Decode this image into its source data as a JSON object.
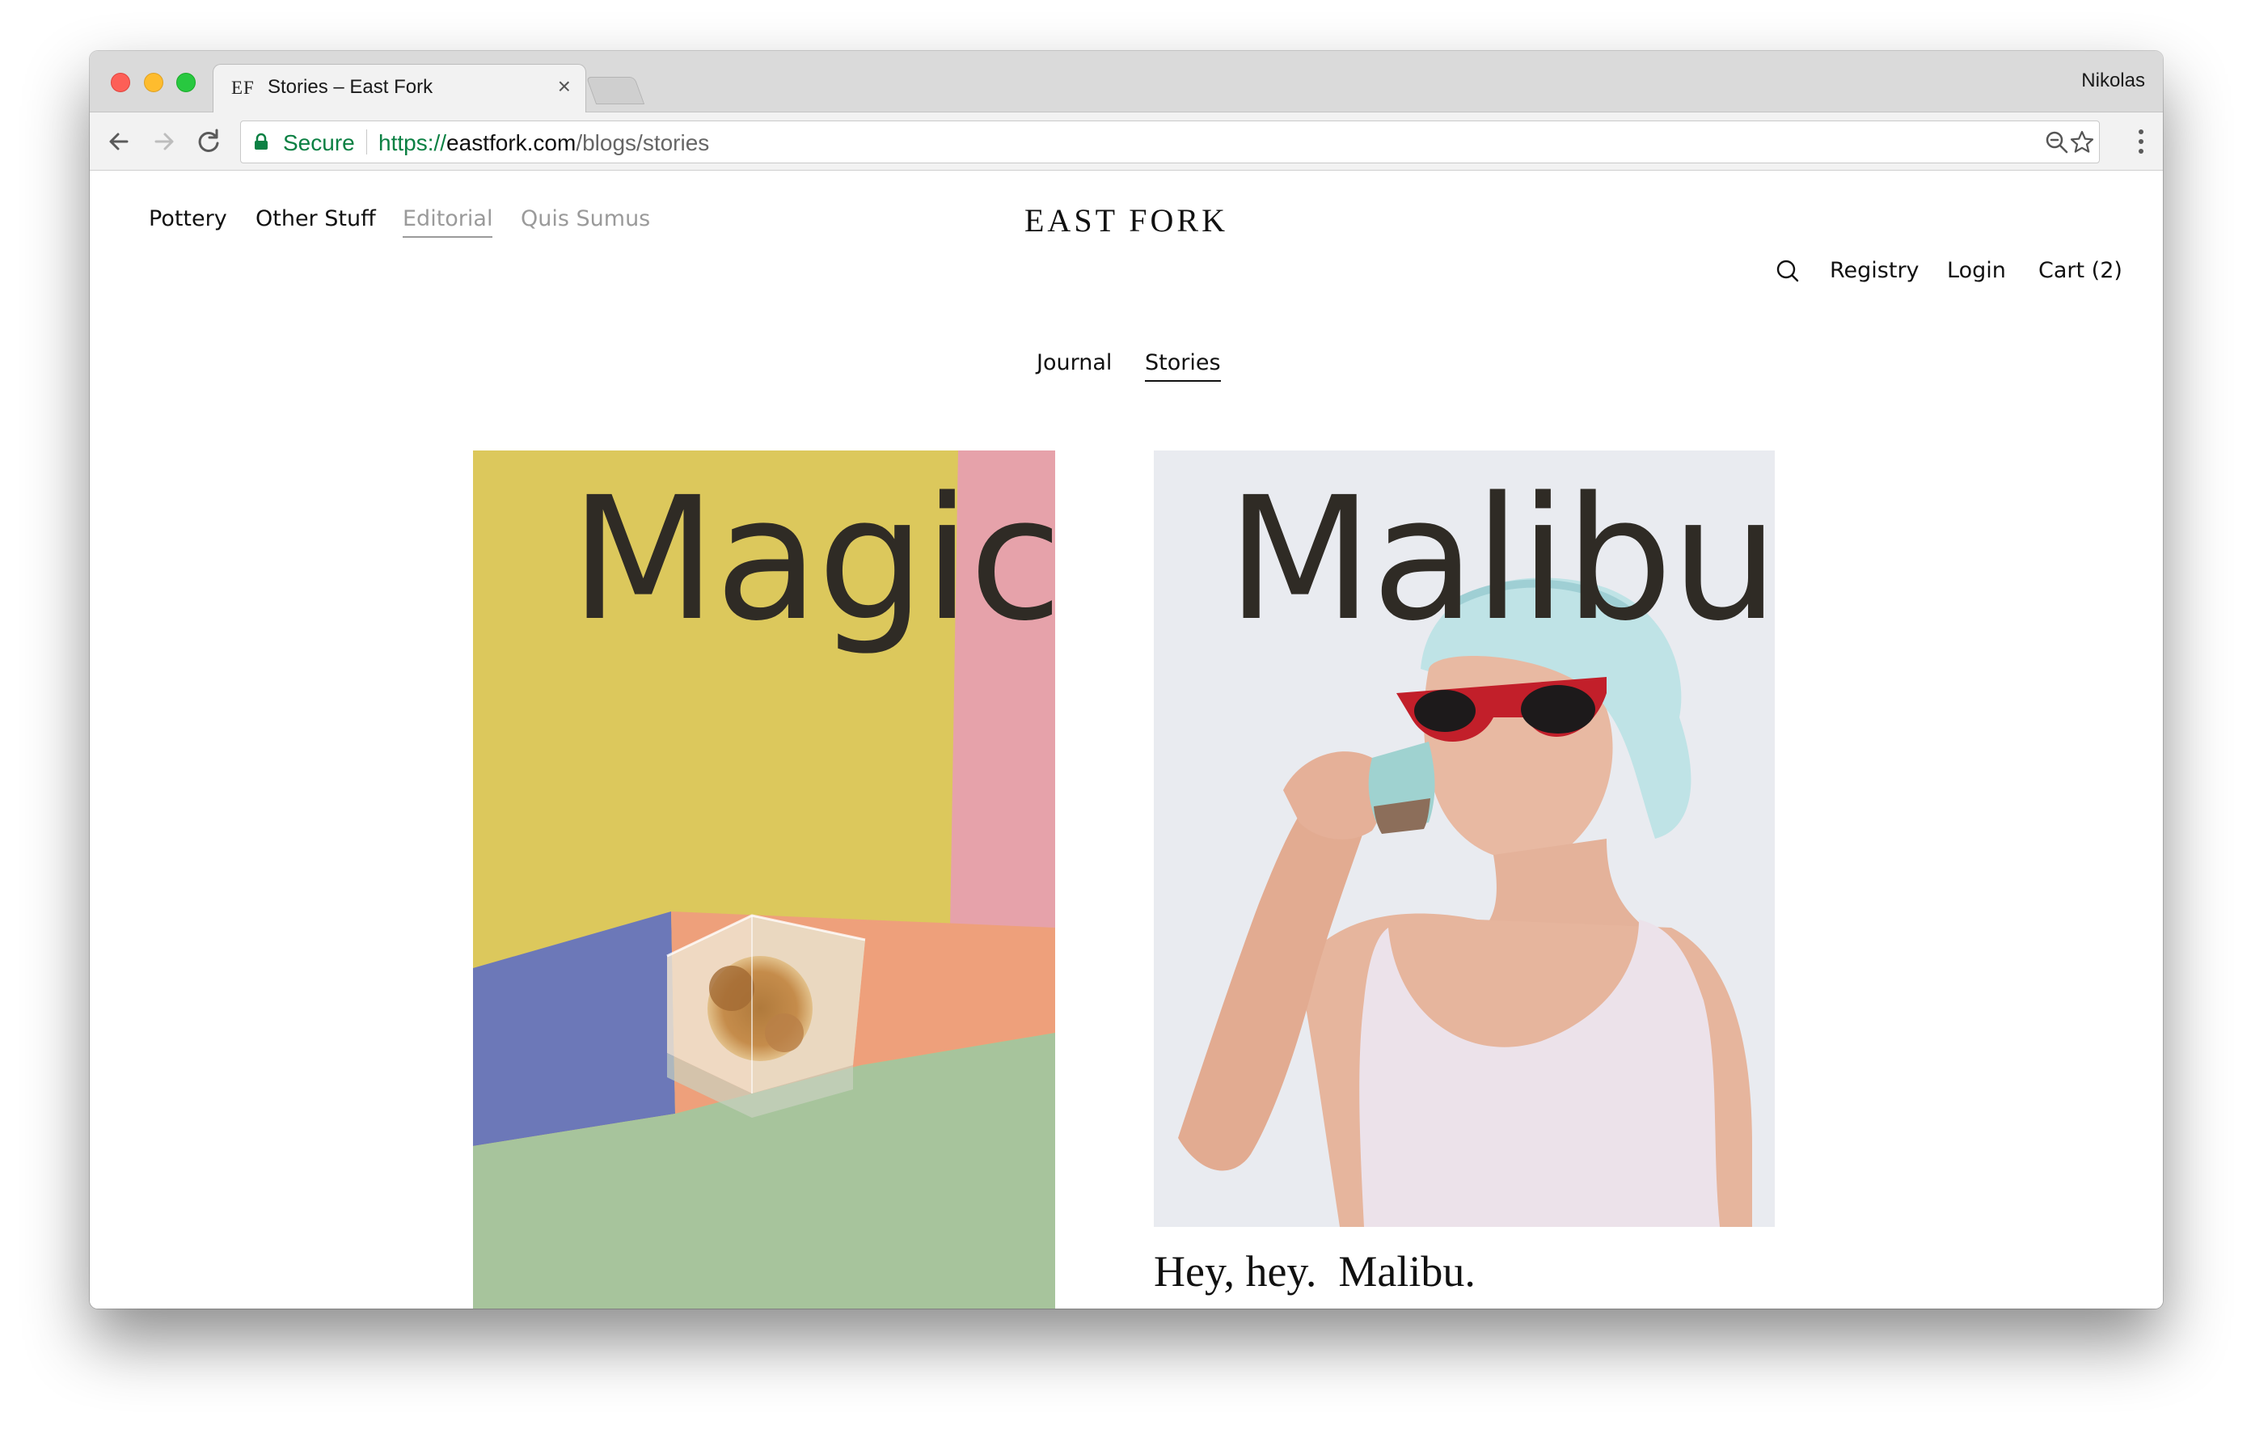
{
  "browser": {
    "tab": {
      "favicon_text": "EF",
      "title": "Stories – East Fork",
      "close_glyph": "×"
    },
    "profile_name": "Nikolas",
    "address": {
      "secure_label": "Secure",
      "url_scheme": "https://",
      "url_host": "eastfork.com",
      "url_path": "/blogs/stories"
    },
    "icons": [
      "back-icon",
      "forward-icon",
      "reload-icon",
      "lock-icon",
      "zoom-icon",
      "bookmark-star-icon",
      "menu-dots-icon"
    ]
  },
  "site": {
    "logo": "EAST FORK",
    "primary_nav": [
      "Pottery",
      "Other Stuff",
      "Editorial",
      "Quis Sumus"
    ],
    "utility_nav": {
      "registry": "Registry",
      "login": "Login",
      "cart": "Cart (2)"
    },
    "sub_nav": [
      "Journal",
      "Stories"
    ],
    "active_primary": "Editorial",
    "active_sub": "Stories"
  },
  "stories": [
    {
      "cover_word": "Magic",
      "image": "resin cube with flowers on pastel yellow, pink, blue and green backdrop",
      "caption": ""
    },
    {
      "cover_word": "Malibu",
      "image": "woman in head towel and red sunglasses drinking from a ceramic cup",
      "caption": "Hey, hey.  Malibu."
    }
  ]
}
